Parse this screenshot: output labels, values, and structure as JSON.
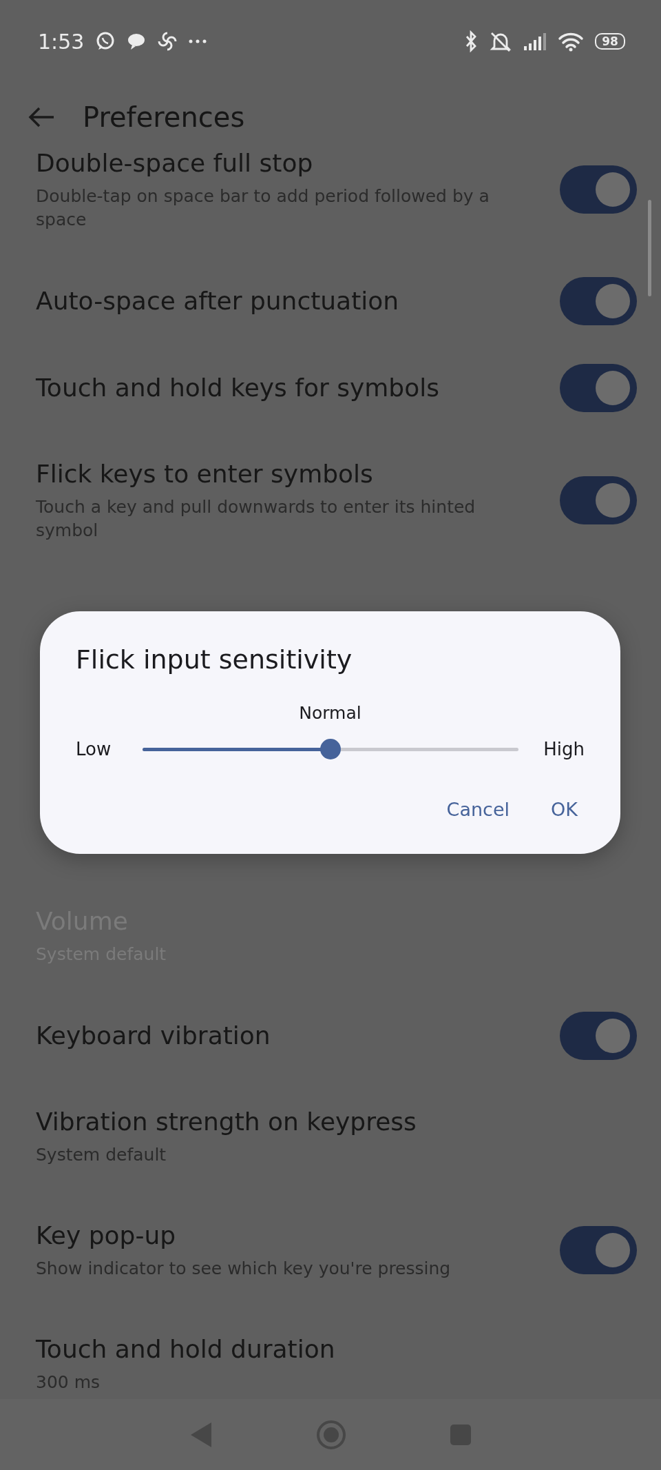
{
  "status_bar": {
    "time": "1:53",
    "battery": "98"
  },
  "app_bar": {
    "title": "Preferences"
  },
  "settings_top": [
    {
      "kind": "toggle",
      "title": "Double-space full stop",
      "subtitle": "Double-tap on space bar to add period followed by a space",
      "on": true,
      "disabled": false
    },
    {
      "kind": "toggle",
      "title": "Auto-space after punctuation",
      "on": true,
      "disabled": false
    },
    {
      "kind": "toggle",
      "title": "Touch and hold keys for symbols",
      "on": true,
      "disabled": false
    },
    {
      "kind": "toggle",
      "title": "Flick keys to enter symbols",
      "subtitle": "Touch a key and pull downwards to enter its hinted symbol",
      "on": true,
      "disabled": false
    }
  ],
  "settings_bottom": [
    {
      "kind": "value",
      "title": "Volume",
      "subtitle": "System default",
      "disabled": true
    },
    {
      "kind": "toggle",
      "title": "Keyboard vibration",
      "on": true,
      "disabled": false
    },
    {
      "kind": "value",
      "title": "Vibration strength on keypress",
      "subtitle": "System default",
      "disabled": false
    },
    {
      "kind": "toggle",
      "title": "Key pop-up",
      "subtitle": "Show indicator to see which key you're pressing",
      "on": true,
      "disabled": false
    },
    {
      "kind": "value",
      "title": "Touch and hold duration",
      "subtitle": "300 ms",
      "disabled": false
    }
  ],
  "dialog": {
    "title": "Flick input sensitivity",
    "slider": {
      "value_label": "Normal",
      "min_label": "Low",
      "max_label": "High",
      "level": 0.5
    },
    "buttons": [
      "Cancel",
      "OK"
    ]
  }
}
